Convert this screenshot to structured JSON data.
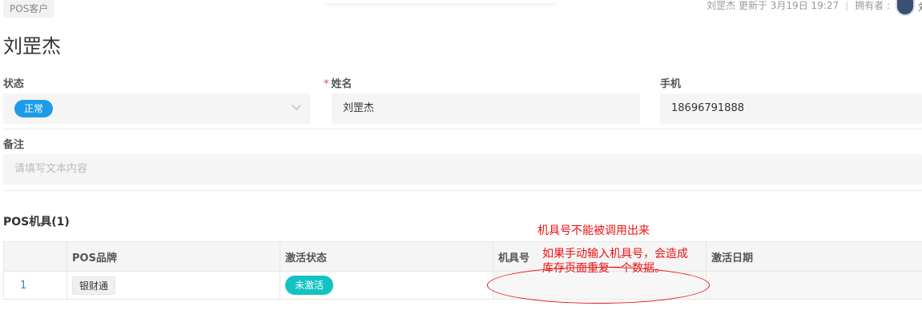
{
  "breadcrumb": {
    "tag": "POS客户"
  },
  "meta": {
    "updated": "刘罡杰 更新于 3月19日 19:27",
    "owner_label": "拥有者 :",
    "owner_trunc": "刘"
  },
  "page_title": "刘罡杰",
  "form": {
    "status": {
      "label": "状态",
      "value": "正常"
    },
    "name": {
      "label": "姓名",
      "required_mark": "*",
      "value": "刘罡杰"
    },
    "phone": {
      "label": "手机",
      "value": "18696791888"
    },
    "remark": {
      "label": "备注",
      "placeholder": "请填写文本内容"
    }
  },
  "pos_section": {
    "title": "POS机具(1)",
    "columns": [
      "POS品牌",
      "激活状态",
      "机具号",
      "激活日期"
    ],
    "rows": [
      {
        "index": "1",
        "brand": "银财通",
        "activation_status": "未激活",
        "device_no": "",
        "activation_date": ""
      }
    ]
  },
  "annotation": {
    "line1": "机具号不能被调用出来",
    "line2": "如果手动输入机具号，会造成",
    "line3": "库存页面重复一个数据。",
    "color": "#e11111"
  },
  "colors": {
    "accent_blue": "#1e9be8",
    "teal": "#13c2c2",
    "link": "#1e88e5"
  }
}
